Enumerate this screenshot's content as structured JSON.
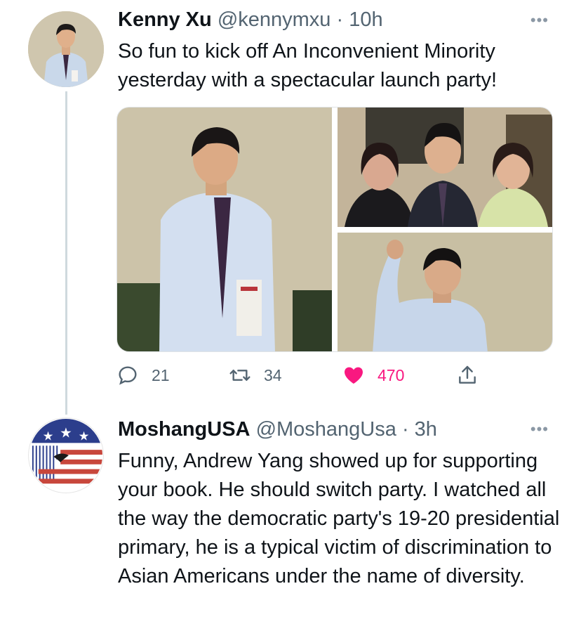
{
  "tweets": [
    {
      "display_name": "Kenny Xu",
      "handle": "@kennymxu",
      "time": "· 10h",
      "text": "So fun to kick off An Inconvenient Minority yesterday with a spectacular launch party!",
      "avatar": "profile-photo-man-in-shirt-and-tie",
      "media": {
        "count": 3,
        "photos": [
          "man-holding-book",
          "group-photo-three-people",
          "man-raising-fist"
        ]
      },
      "stats": {
        "replies": "21",
        "retweets": "34",
        "likes": "470"
      },
      "liked": true
    },
    {
      "display_name": "MoshangUSA",
      "handle": "@MoshangUsa",
      "time": "· 3h",
      "text": "Funny, Andrew Yang showed up for supporting your book. He should switch party. I watched all the way the democratic party's 19-20 presidential primary, he is a typical victim of discrimination to Asian Americans under the name of diversity.",
      "avatar": "us-flag-stars-stripes-eagle-logo"
    }
  ],
  "more_label": "•••",
  "icons": {
    "reply": "reply-icon",
    "retweet": "retweet-icon",
    "like": "heart-icon",
    "share": "share-icon",
    "more": "more-options-icon"
  },
  "colors": {
    "like": "#f91880",
    "secondary_text": "#536471",
    "thread_line": "#cfd9de"
  }
}
